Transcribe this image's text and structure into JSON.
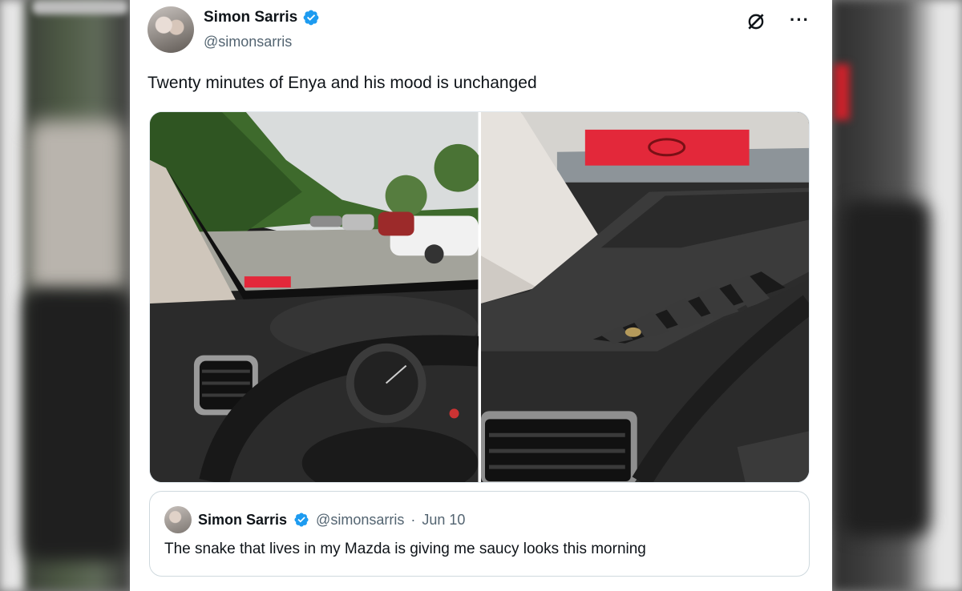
{
  "colors": {
    "verified_blue": "#1d9bf0",
    "text_primary": "#0f1419",
    "text_secondary": "#536471"
  },
  "tweet": {
    "author_name": "Simon Sarris",
    "author_handle": "@simonsarris",
    "text": "Twenty minutes of Enya and his mood is unchanged",
    "media": [
      {
        "description_icon": "photo-car-interior-parking-lot"
      },
      {
        "description_icon": "photo-dashboard-vent-snake"
      }
    ],
    "icons": [
      "avatar",
      "verified-badge-icon",
      "grok-icon",
      "more-icon"
    ]
  },
  "quoted_tweet": {
    "author_name": "Simon Sarris",
    "author_handle": "@simonsarris",
    "separator": "·",
    "date": "Jun 10",
    "text": "The snake that lives in my Mazda is giving me saucy looks this morning"
  }
}
